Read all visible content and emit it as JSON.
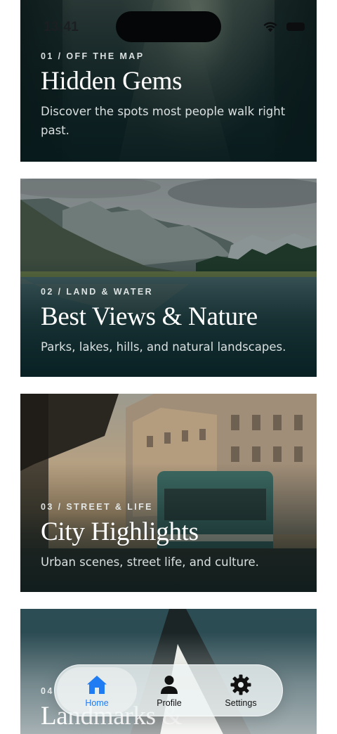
{
  "status_bar": {
    "time": "13:41"
  },
  "cards": [
    {
      "number": "01 / OFF THE MAP",
      "title": "Hidden Gems",
      "subtitle": "Discover the spots most people walk right past."
    },
    {
      "number": "02 / LAND & WATER",
      "title": "Best Views & Nature",
      "subtitle": "Parks, lakes, hills, and natural landscapes."
    },
    {
      "number": "03 / STREET & LIFE",
      "title": "City Highlights",
      "subtitle": "Urban scenes, street life, and culture."
    },
    {
      "number": "04",
      "title": "Landmarks &",
      "subtitle": ""
    }
  ],
  "tabs": [
    {
      "label": "Home",
      "icon": "house-icon",
      "active": true
    },
    {
      "label": "Profile",
      "icon": "person-icon",
      "active": false
    },
    {
      "label": "Settings",
      "icon": "gear-icon",
      "active": false
    }
  ],
  "colors": {
    "accent": "#1f7cf2",
    "card_overlay": "#0b2a2c"
  }
}
